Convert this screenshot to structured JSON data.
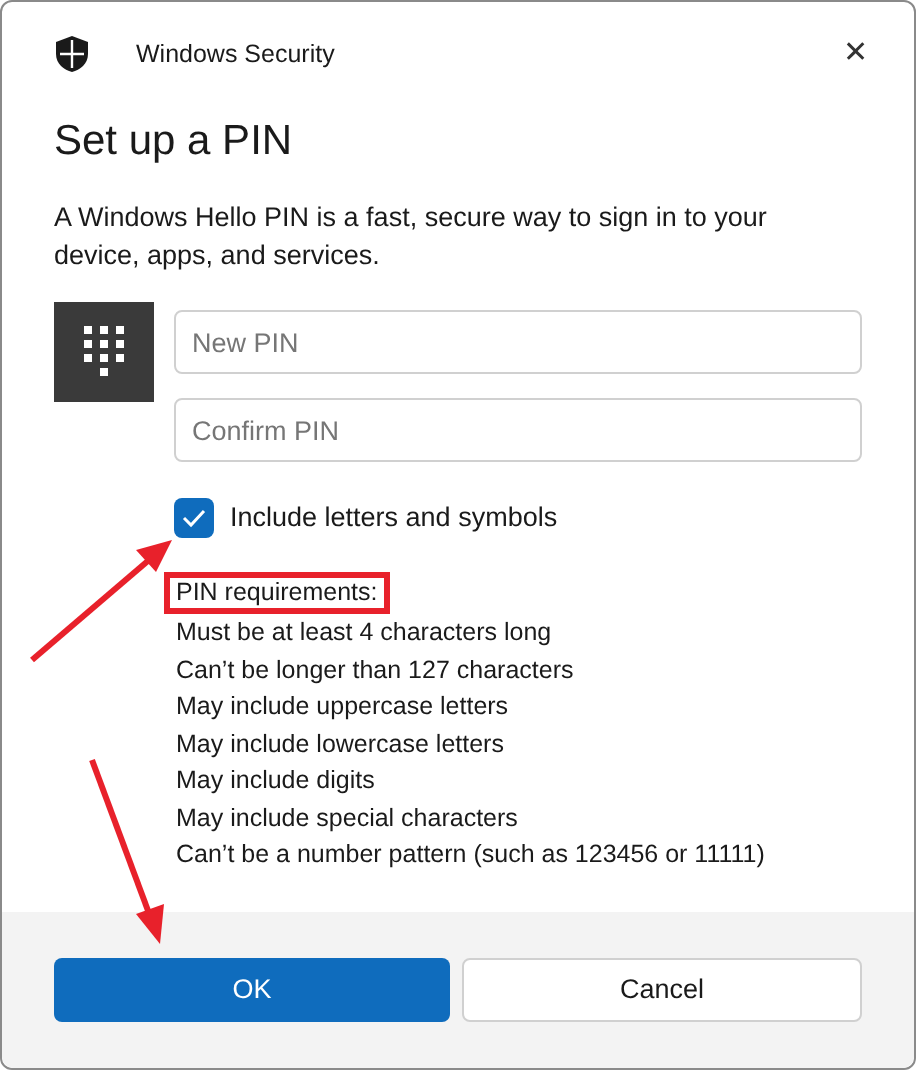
{
  "window": {
    "title": "Windows Security",
    "close": "✕"
  },
  "heading": "Set up a PIN",
  "description": "A Windows Hello PIN is a fast, secure way to sign in to your device, apps, and services.",
  "fields": [
    {
      "placeholder": "New PIN"
    },
    {
      "placeholder": "Confirm PIN"
    }
  ],
  "checkbox": {
    "label": "Include letters and symbols",
    "checked": true
  },
  "requirements": {
    "title": "PIN requirements:",
    "highlighted": true,
    "items": [
      "Must be at least 4 characters long",
      "Can’t be longer than 127 characters",
      "May include uppercase letters",
      "May include lowercase letters",
      "May include digits",
      "May include special characters",
      "Can’t be a number pattern (such as 123456 or 11111)"
    ]
  },
  "buttons": [
    {
      "label": "OK",
      "kind": "primary"
    },
    {
      "label": "Cancel",
      "kind": "secondary"
    }
  ]
}
